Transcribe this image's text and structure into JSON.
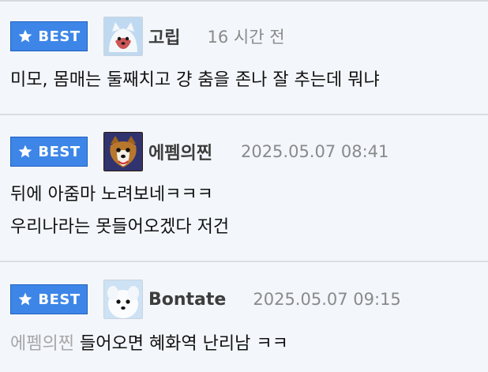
{
  "badge_label": "BEST",
  "comments": [
    {
      "author": "고립",
      "time": "16 시간 전",
      "avatar": "white-fox-avatar-icon",
      "lines": [
        "미모, 몸매는 둘째치고 걍 춤을 존나 잘 추는데 뭐냐"
      ]
    },
    {
      "author": "에펨의찐",
      "time": "2025.05.07 08:41",
      "avatar": "dog-avatar-icon",
      "lines": [
        "뒤에 아줌마 노려보네ㅋㅋㅋ",
        "우리나라는 못들어오겠다 저건"
      ]
    },
    {
      "author": "Bontate",
      "time": "2025.05.07 09:15",
      "avatar": "white-puppy-avatar-icon",
      "mention": "에펨의찐",
      "lines": [
        "들어오면 혜화역 난리남 ㅋㅋ"
      ]
    }
  ],
  "colors": {
    "badge": "#3d86e8",
    "background": "#f3f6fb",
    "divider": "#d9dde3",
    "time": "#8a8a8a",
    "mention": "#a7a7a7"
  }
}
